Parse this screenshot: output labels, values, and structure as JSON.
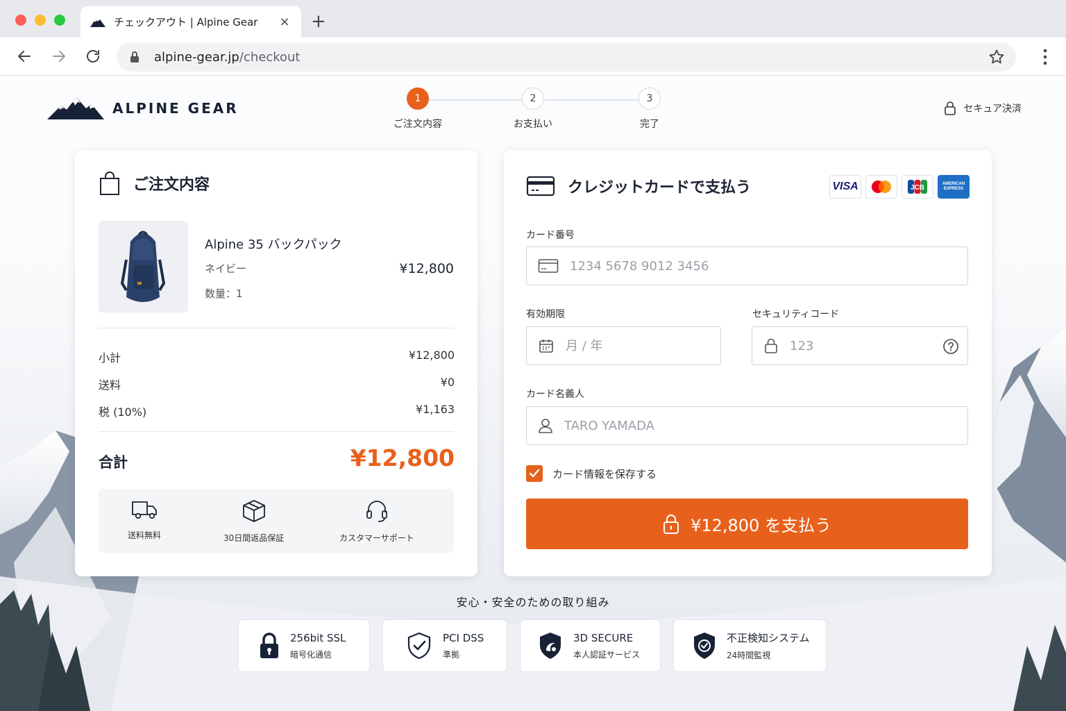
{
  "browser": {
    "tab_title": "チェックアウト | Alpine Gear",
    "close_glyph": "×",
    "newtab_glyph": "+",
    "url_domain": "alpine-gear.jp",
    "url_path": "/checkout"
  },
  "header": {
    "brand_name": "ALPINE GEAR",
    "secure_label": "セキュア決済",
    "steps": [
      {
        "num": "1",
        "label": "ご注文内容"
      },
      {
        "num": "2",
        "label": "お支払い"
      },
      {
        "num": "3",
        "label": "完了"
      }
    ],
    "active_step": 1
  },
  "order": {
    "title": "ご注文内容",
    "product": {
      "name": "Alpine 35 バックパック",
      "color": "ネイビー",
      "qty": "数量：1",
      "price": "¥12,800"
    },
    "rows": [
      {
        "label": "小計",
        "value": "¥12,800"
      },
      {
        "label": "送料",
        "value": "¥0"
      },
      {
        "label": "税 (10%)",
        "value": "¥1,163"
      }
    ],
    "total_label": "合計",
    "total_value": "¥12,800",
    "perks": [
      "送料無料",
      "30日間返品保証",
      "カスタマーサポート"
    ]
  },
  "payment": {
    "title": "クレジットカードで支払う",
    "card_brands": [
      "VISA",
      "Mastercard",
      "JCB",
      "AMERICAN EXPRESS"
    ],
    "card_number": {
      "label": "カード番号",
      "placeholder": "1234 5678 9012 3456",
      "value": ""
    },
    "expiry": {
      "label": "有効期限",
      "placeholder": "月 / 年",
      "value": ""
    },
    "cvc": {
      "label": "セキュリティコード",
      "placeholder": "123",
      "value": ""
    },
    "holder": {
      "label": "カード名義人",
      "placeholder": "TARO YAMADA",
      "value": ""
    },
    "save_card": {
      "label": "カード情報を保存する",
      "checked": true
    },
    "pay_button": "¥12,800 を支払う"
  },
  "trust": {
    "title": "安心・安全のための取り組み",
    "items": [
      {
        "title": "256bit SSL",
        "sub": "暗号化通信"
      },
      {
        "title": "PCI DSS",
        "sub": "準拠"
      },
      {
        "title": "3D SECURE",
        "sub": "本人認証サービス"
      },
      {
        "title": "不正検知システム",
        "sub": "24時間監視"
      }
    ]
  },
  "colors": {
    "accent": "#e8611c",
    "text": "#1d2433",
    "brand_dark": "#172236"
  }
}
